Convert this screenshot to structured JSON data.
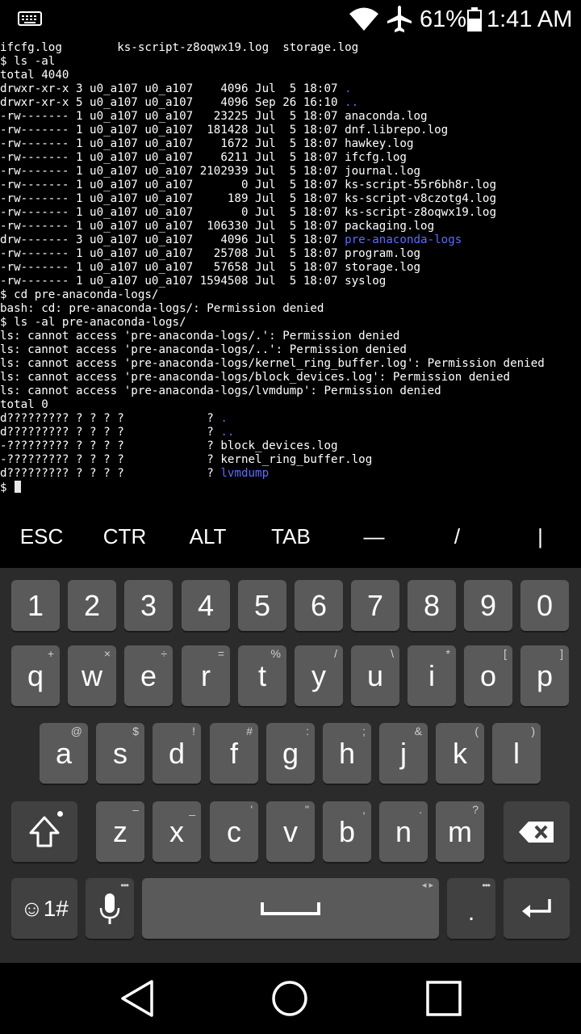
{
  "status_bar": {
    "keyboard_icon": "keyboard-icon",
    "wifi_icon": "wifi-icon",
    "airplane_icon": "airplane-mode-icon",
    "battery_percent": "61%",
    "battery_icon": "battery-icon",
    "time": "1:41 AM"
  },
  "terminal": {
    "lines": [
      {
        "text": "ifcfg.log        ks-script-z8oqwx19.log  storage.log"
      },
      {
        "text": "$ ls -al"
      },
      {
        "text": "total 4040"
      },
      {
        "text": "drwxr-xr-x 3 u0_a107 u0_a107    4096 Jul  5 18:07 ",
        "dir": "."
      },
      {
        "text": "drwxr-xr-x 5 u0_a107 u0_a107    4096 Sep 26 16:10 ",
        "dir": ".."
      },
      {
        "text": "-rw------- 1 u0_a107 u0_a107   23225 Jul  5 18:07 anaconda.log"
      },
      {
        "text": "-rw------- 1 u0_a107 u0_a107  181428 Jul  5 18:07 dnf.librepo.log"
      },
      {
        "text": "-rw------- 1 u0_a107 u0_a107    1672 Jul  5 18:07 hawkey.log"
      },
      {
        "text": "-rw------- 1 u0_a107 u0_a107    6211 Jul  5 18:07 ifcfg.log"
      },
      {
        "text": "-rw------- 1 u0_a107 u0_a107 2102939 Jul  5 18:07 journal.log"
      },
      {
        "text": "-rw------- 1 u0_a107 u0_a107       0 Jul  5 18:07 ks-script-55r6bh8r.log"
      },
      {
        "text": "-rw------- 1 u0_a107 u0_a107     189 Jul  5 18:07 ks-script-v8czotg4.log"
      },
      {
        "text": "-rw------- 1 u0_a107 u0_a107       0 Jul  5 18:07 ks-script-z8oqwx19.log"
      },
      {
        "text": "-rw------- 1 u0_a107 u0_a107  106330 Jul  5 18:07 packaging.log"
      },
      {
        "text": "drw------- 3 u0_a107 u0_a107    4096 Jul  5 18:07 ",
        "dir": "pre-anaconda-logs"
      },
      {
        "text": "-rw------- 1 u0_a107 u0_a107   25708 Jul  5 18:07 program.log"
      },
      {
        "text": "-rw------- 1 u0_a107 u0_a107   57658 Jul  5 18:07 storage.log"
      },
      {
        "text": "-rw------- 1 u0_a107 u0_a107 1594508 Jul  5 18:07 syslog"
      },
      {
        "text": "$ cd pre-anaconda-logs/"
      },
      {
        "text": "bash: cd: pre-anaconda-logs/: Permission denied"
      },
      {
        "text": "$ ls -al pre-anaconda-logs/"
      },
      {
        "text": "ls: cannot access 'pre-anaconda-logs/.': Permission denied"
      },
      {
        "text": "ls: cannot access 'pre-anaconda-logs/..': Permission denied"
      },
      {
        "text": "ls: cannot access 'pre-anaconda-logs/kernel_ring_buffer.log': Permission denied"
      },
      {
        "text": "ls: cannot access 'pre-anaconda-logs/block_devices.log': Permission denied"
      },
      {
        "text": "ls: cannot access 'pre-anaconda-logs/lvmdump': Permission denied"
      },
      {
        "text": "total 0"
      },
      {
        "text": "d????????? ? ? ? ?            ? ",
        "dir": "."
      },
      {
        "text": "d????????? ? ? ? ?            ? ",
        "dir": ".."
      },
      {
        "text": "-????????? ? ? ? ?            ? block_devices.log"
      },
      {
        "text": "-????????? ? ? ? ?            ? kernel_ring_buffer.log"
      },
      {
        "text": "d????????? ? ? ? ?            ? ",
        "dir": "lvmdump"
      }
    ],
    "prompt": "$ "
  },
  "extra_keys": [
    "ESC",
    "CTR",
    "ALT",
    "TAB",
    "—",
    "/",
    "|"
  ],
  "keyboard": {
    "number_row": [
      "1",
      "2",
      "3",
      "4",
      "5",
      "6",
      "7",
      "8",
      "9",
      "0"
    ],
    "row1": [
      {
        "key": "q",
        "hint": "+"
      },
      {
        "key": "w",
        "hint": "×"
      },
      {
        "key": "e",
        "hint": "÷"
      },
      {
        "key": "r",
        "hint": "="
      },
      {
        "key": "t",
        "hint": "%"
      },
      {
        "key": "y",
        "hint": "/"
      },
      {
        "key": "u",
        "hint": "\\"
      },
      {
        "key": "i",
        "hint": "*"
      },
      {
        "key": "o",
        "hint": "["
      },
      {
        "key": "p",
        "hint": "]"
      }
    ],
    "row2": [
      {
        "key": "a",
        "hint": "@"
      },
      {
        "key": "s",
        "hint": "$"
      },
      {
        "key": "d",
        "hint": "!"
      },
      {
        "key": "f",
        "hint": "#"
      },
      {
        "key": "g",
        "hint": ":"
      },
      {
        "key": "h",
        "hint": ";"
      },
      {
        "key": "j",
        "hint": "&"
      },
      {
        "key": "k",
        "hint": "("
      },
      {
        "key": "l",
        "hint": ")"
      }
    ],
    "row3": [
      {
        "key": "z",
        "hint": "–"
      },
      {
        "key": "x",
        "hint": "_"
      },
      {
        "key": "c",
        "hint": "'"
      },
      {
        "key": "v",
        "hint": "\""
      },
      {
        "key": "b",
        "hint": ","
      },
      {
        "key": "n",
        "hint": "."
      },
      {
        "key": "m",
        "hint": "?"
      }
    ],
    "symbols_label": "☺1#",
    "period_label": ".",
    "space_hint": "◂ ▸",
    "more_hint": "•••"
  }
}
